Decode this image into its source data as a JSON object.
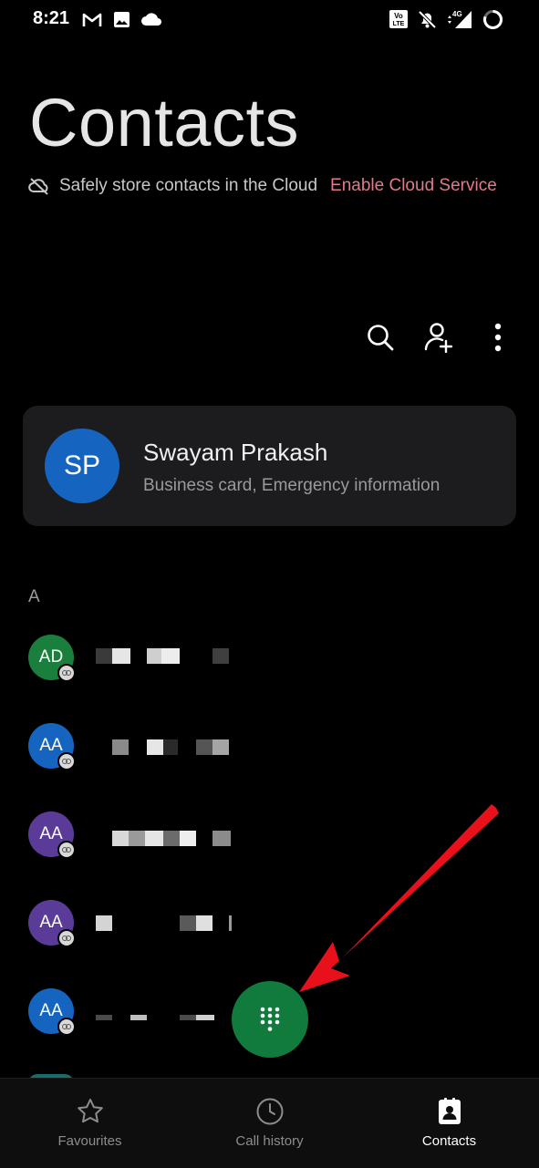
{
  "status_bar": {
    "time": "8:21",
    "network": "4G",
    "volte": "Vo LTE"
  },
  "header": {
    "title": "Contacts",
    "cloud_text": "Safely store contacts in the Cloud",
    "cloud_link": "Enable Cloud Service"
  },
  "profile": {
    "initials": "SP",
    "name": "Swayam Prakash",
    "subtitle": "Business card, Emergency information"
  },
  "section_letter": "A",
  "contacts": [
    {
      "initials": "AD",
      "color": "#1a7f3c"
    },
    {
      "initials": "AA",
      "color": "#1565c0"
    },
    {
      "initials": "AA",
      "color": "#5b3b98"
    },
    {
      "initials": "AA",
      "color": "#5b3b98"
    },
    {
      "initials": "AA",
      "color": "#1565c0"
    }
  ],
  "bottom_nav": [
    {
      "label": "Favourites",
      "icon": "star-icon"
    },
    {
      "label": "Call history",
      "icon": "clock-icon"
    },
    {
      "label": "Contacts",
      "icon": "contact-book-icon",
      "active": true
    }
  ],
  "colors": {
    "accent_link": "#e07a8c",
    "fab": "#117a3d",
    "annotation_arrow": "#e8101a"
  }
}
